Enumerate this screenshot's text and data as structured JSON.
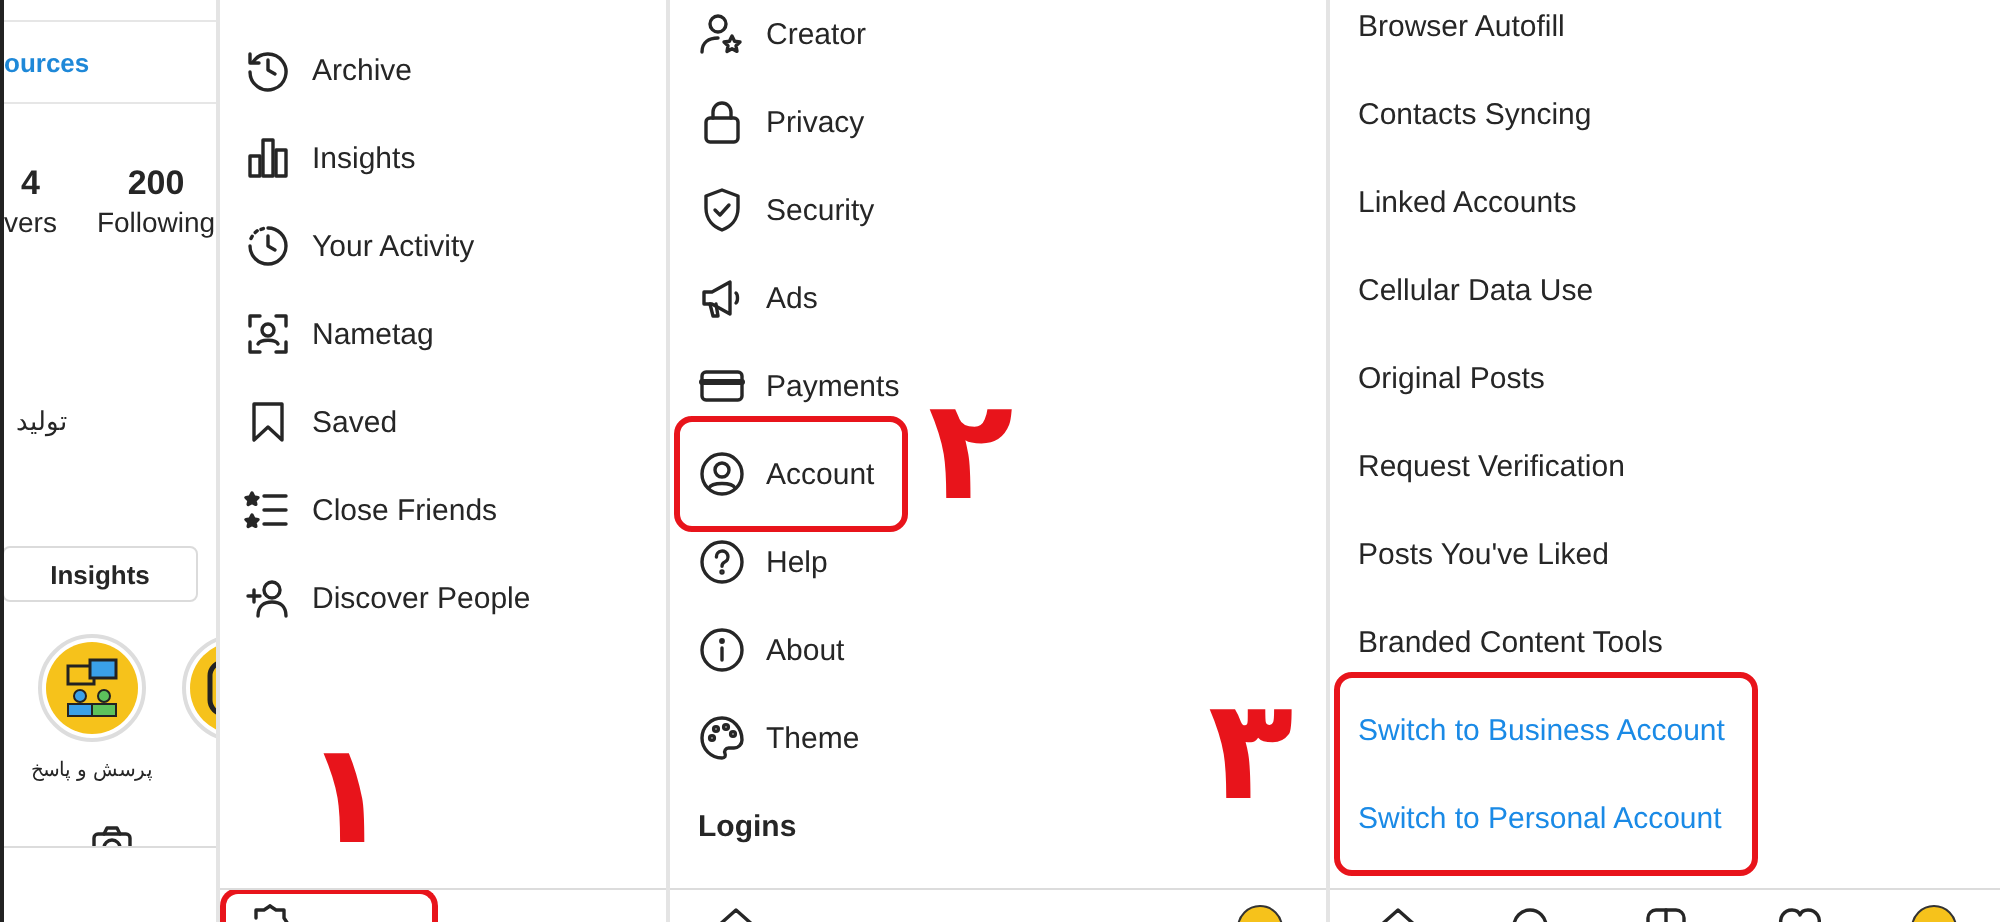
{
  "profile_panel": {
    "link": "ources",
    "stats": [
      {
        "value": "4",
        "label": "vers"
      },
      {
        "value": "200",
        "label": "Following"
      }
    ],
    "bio": "تولید",
    "button": "Insights",
    "highlights": [
      {
        "label": "پرسش و پاسخ"
      }
    ]
  },
  "menu_panel": {
    "items": [
      {
        "label": "Archive"
      },
      {
        "label": "Insights"
      },
      {
        "label": "Your Activity"
      },
      {
        "label": "Nametag"
      },
      {
        "label": "Saved"
      },
      {
        "label": "Close Friends"
      },
      {
        "label": "Discover People"
      }
    ],
    "settings_tab_highlighted": true
  },
  "settings_panel": {
    "items": [
      {
        "kind": "row",
        "label": "Creator",
        "highlighted": false
      },
      {
        "kind": "row",
        "label": "Privacy",
        "highlighted": false
      },
      {
        "kind": "row",
        "label": "Security",
        "highlighted": false
      },
      {
        "kind": "row",
        "label": "Ads",
        "highlighted": false
      },
      {
        "kind": "row",
        "label": "Payments",
        "highlighted": false
      },
      {
        "kind": "row",
        "label": "Account",
        "highlighted": true
      },
      {
        "kind": "row",
        "label": "Help",
        "highlighted": false
      },
      {
        "kind": "row",
        "label": "About",
        "highlighted": false
      },
      {
        "kind": "row",
        "label": "Theme",
        "highlighted": false
      },
      {
        "kind": "heading",
        "label": "Logins",
        "highlighted": false
      }
    ]
  },
  "account_panel": {
    "items": [
      {
        "kind": "row",
        "label": "Browser Autofill",
        "highlighted": false
      },
      {
        "kind": "row",
        "label": "Contacts Syncing",
        "highlighted": false
      },
      {
        "kind": "row",
        "label": "Linked Accounts",
        "highlighted": false
      },
      {
        "kind": "row",
        "label": "Cellular Data Use",
        "highlighted": false
      },
      {
        "kind": "row",
        "label": "Original Posts",
        "highlighted": false
      },
      {
        "kind": "row",
        "label": "Request Verification",
        "highlighted": false
      },
      {
        "kind": "row",
        "label": "Posts You've Liked",
        "highlighted": false
      },
      {
        "kind": "row",
        "label": "Branded Content Tools",
        "highlighted": false
      },
      {
        "kind": "link",
        "label": "Switch to Business Account",
        "highlighted": true
      },
      {
        "kind": "link",
        "label": "Switch to Personal Account",
        "highlighted": true
      }
    ]
  },
  "annotations": [
    {
      "text": "۱"
    },
    {
      "text": "۲"
    },
    {
      "text": "۳"
    }
  ]
}
